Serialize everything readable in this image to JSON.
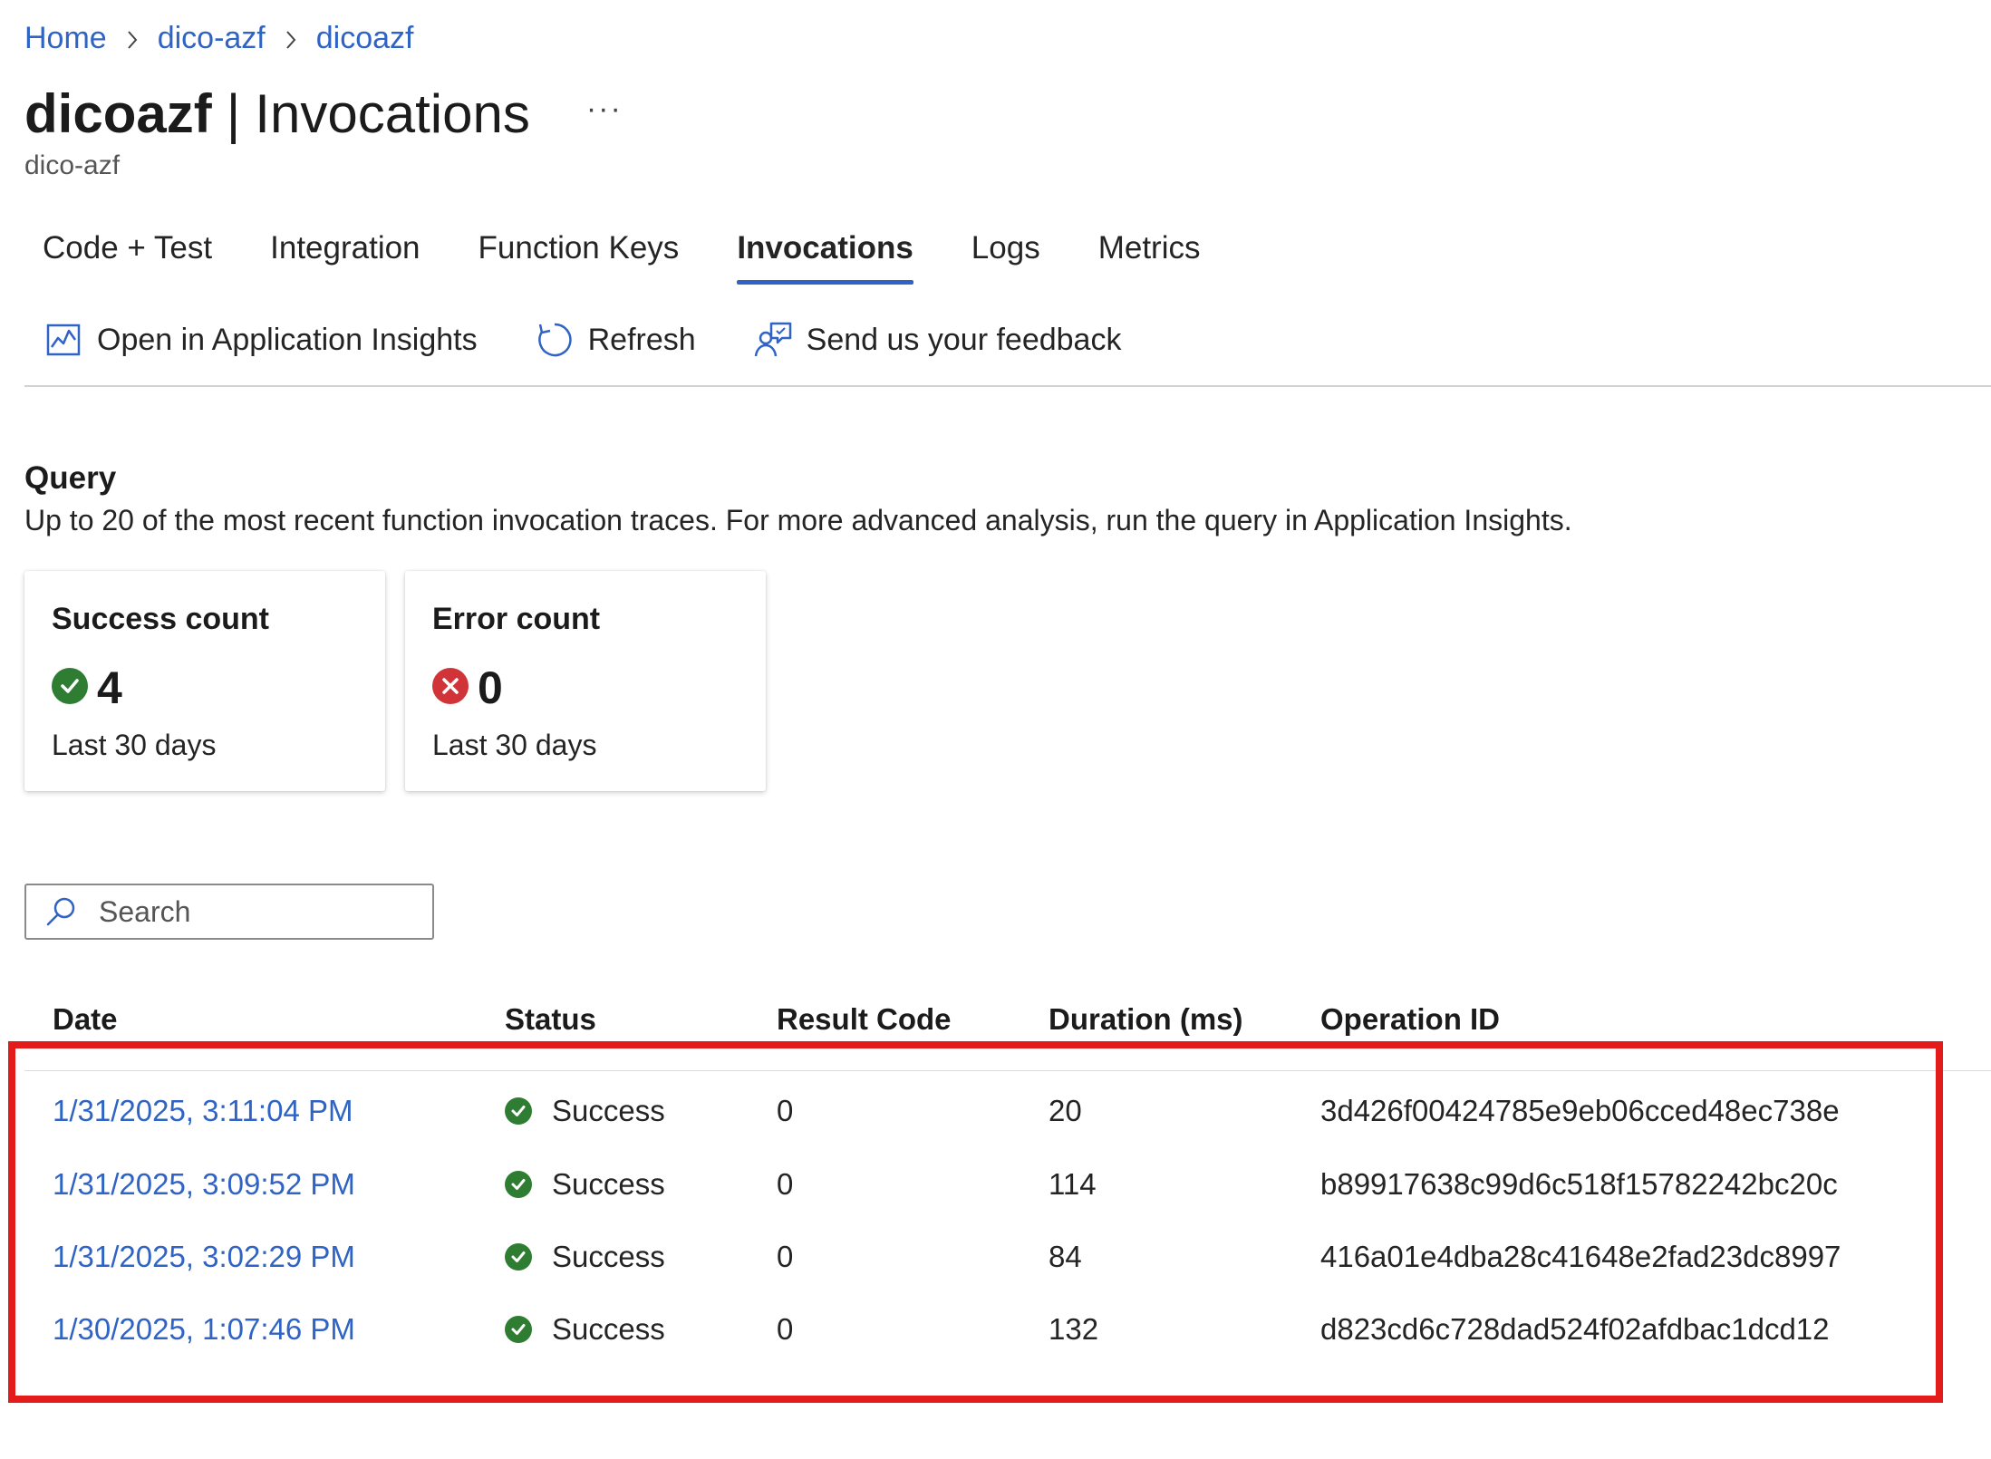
{
  "breadcrumb": {
    "items": [
      "Home",
      "dico-azf",
      "dicoazf"
    ]
  },
  "title": {
    "name": "dicoazf",
    "separator": "|",
    "page": "Invocations",
    "more": "···",
    "subtitle": "dico-azf"
  },
  "tabs": [
    {
      "label": "Code + Test",
      "active": false
    },
    {
      "label": "Integration",
      "active": false
    },
    {
      "label": "Function Keys",
      "active": false
    },
    {
      "label": "Invocations",
      "active": true
    },
    {
      "label": "Logs",
      "active": false
    },
    {
      "label": "Metrics",
      "active": false
    }
  ],
  "toolbar": {
    "open_insights": {
      "label": "Open in Application Insights",
      "icon": "chart-icon"
    },
    "refresh": {
      "label": "Refresh",
      "icon": "refresh-icon"
    },
    "feedback": {
      "label": "Send us your feedback",
      "icon": "feedback-icon"
    }
  },
  "query": {
    "heading": "Query",
    "description": "Up to 20 of the most recent function invocation traces. For more advanced analysis, run the query in Application Insights."
  },
  "cards": {
    "success": {
      "title": "Success count",
      "value": "4",
      "period": "Last 30 days",
      "icon": "success-icon",
      "color": "#2e7d32"
    },
    "error": {
      "title": "Error count",
      "value": "0",
      "period": "Last 30 days",
      "icon": "error-icon",
      "color": "#d13438"
    }
  },
  "search": {
    "placeholder": "Search",
    "value": ""
  },
  "table": {
    "headers": {
      "date": "Date",
      "status": "Status",
      "result_code": "Result Code",
      "duration": "Duration (ms)",
      "operation_id": "Operation ID"
    },
    "rows": [
      {
        "date": "1/31/2025, 3:11:04 PM",
        "status": "Success",
        "result_code": "0",
        "duration": "20",
        "operation_id": "3d426f00424785e9eb06cced48ec738e"
      },
      {
        "date": "1/31/2025, 3:09:52 PM",
        "status": "Success",
        "result_code": "0",
        "duration": "114",
        "operation_id": "b89917638c99d6c518f15782242bc20c"
      },
      {
        "date": "1/31/2025, 3:02:29 PM",
        "status": "Success",
        "result_code": "0",
        "duration": "84",
        "operation_id": "416a01e4dba28c41648e2fad23dc8997"
      },
      {
        "date": "1/30/2025, 1:07:46 PM",
        "status": "Success",
        "result_code": "0",
        "duration": "132",
        "operation_id": "d823cd6c728dad524f02afdbac1dcd12"
      }
    ]
  },
  "colors": {
    "link": "#2f63c4",
    "accent": "#2f63c4",
    "success": "#2e7d32",
    "error": "#d13438",
    "highlight": "#e31b1b"
  }
}
